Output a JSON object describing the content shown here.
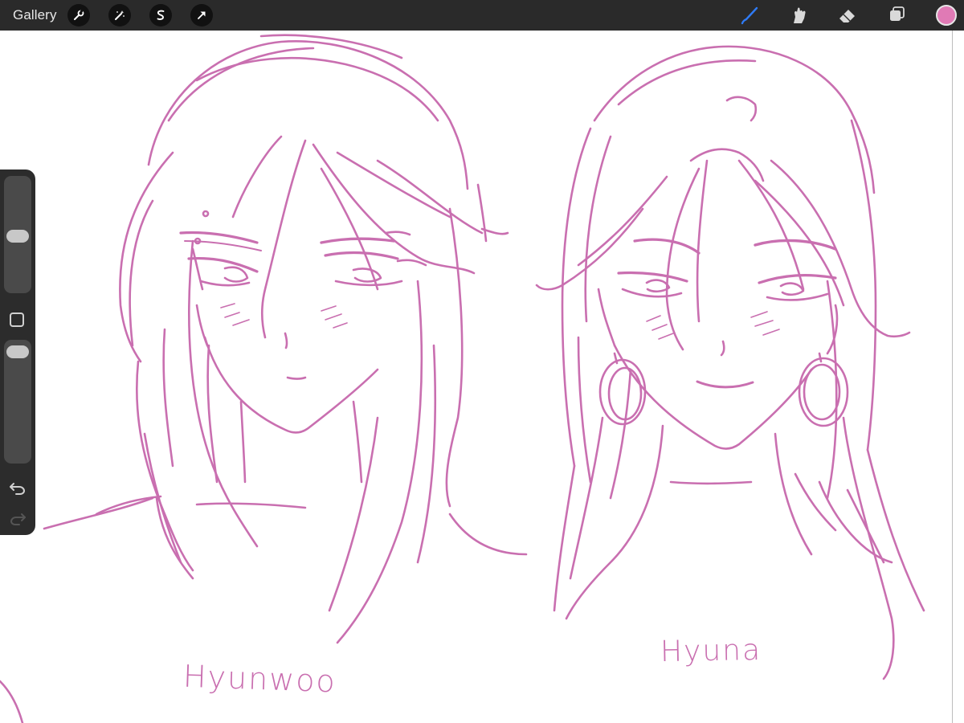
{
  "toolbar": {
    "gallery_label": "Gallery",
    "left_tools": [
      {
        "name": "actions",
        "icon": "wrench-icon"
      },
      {
        "name": "adjustments",
        "icon": "magic-wand-icon"
      },
      {
        "name": "selection",
        "icon": "selection-s-icon"
      },
      {
        "name": "transform",
        "icon": "arrow-cursor-icon"
      }
    ],
    "right_tools": [
      {
        "name": "brush",
        "icon": "brush-icon",
        "active": true
      },
      {
        "name": "smudge",
        "icon": "smudge-finger-icon",
        "active": false
      },
      {
        "name": "eraser",
        "icon": "eraser-icon",
        "active": false
      },
      {
        "name": "layers",
        "icon": "layers-icon",
        "active": false
      }
    ],
    "active_tool_color": "#2f7bf5",
    "current_color": "#e07ab5"
  },
  "sidebar": {
    "brush_size": 0.48,
    "opacity": 0.03,
    "modify_icon": "square-icon",
    "undo_icon": "undo-arrow-icon",
    "redo_icon": "redo-arrow-icon"
  },
  "canvas": {
    "stroke_color": "#c96fb0",
    "background": "#ffffff",
    "signatures": {
      "left": "Hyunwoo",
      "right": "Hyuna"
    }
  }
}
